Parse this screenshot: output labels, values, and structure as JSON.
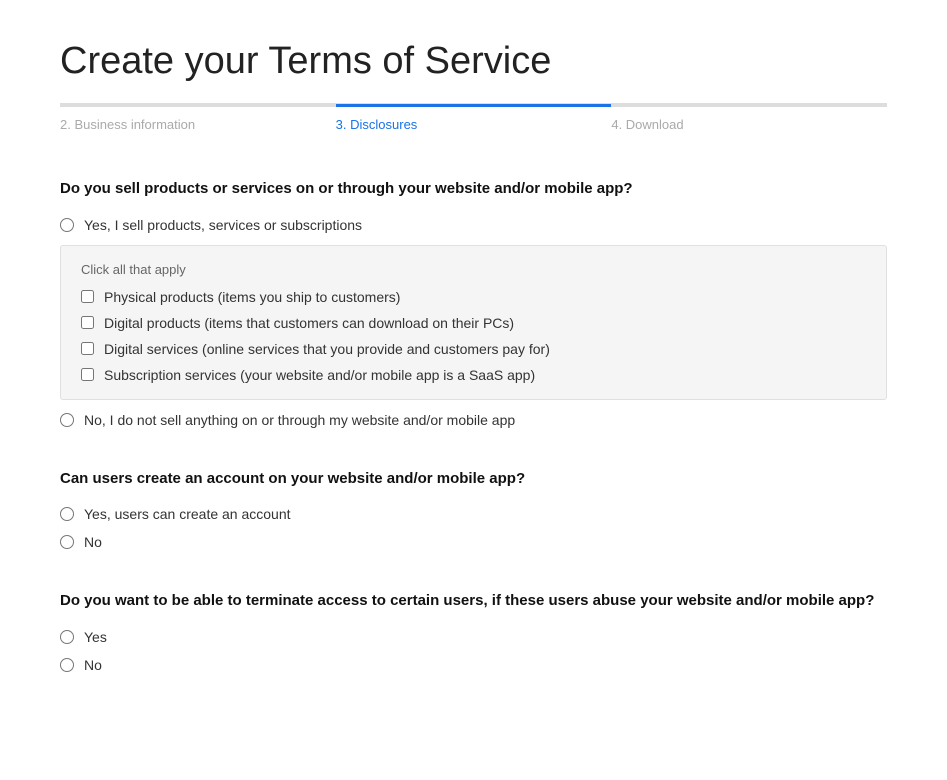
{
  "page": {
    "title": "Create your Terms of Service"
  },
  "stepper": {
    "steps": [
      {
        "id": "business-info",
        "label": "2. Business information",
        "state": "inactive"
      },
      {
        "id": "disclosures",
        "label": "3. Disclosures",
        "state": "active"
      },
      {
        "id": "download",
        "label": "4. Download",
        "state": "inactive"
      }
    ]
  },
  "sections": [
    {
      "id": "sell-products",
      "question": "Do you sell products or services on or through your website and/or mobile app?",
      "options": [
        {
          "id": "sell-yes",
          "label": "Yes, I sell products, services or subscriptions",
          "hasSubgroup": true
        },
        {
          "id": "sell-no",
          "label": "No, I do not sell anything on or through my website and/or mobile app",
          "hasSubgroup": false
        }
      ],
      "subgroup": {
        "label": "Click all that apply",
        "checkboxes": [
          {
            "id": "physical",
            "label": "Physical products (items you ship to customers)"
          },
          {
            "id": "digital-products",
            "label": "Digital products (items that customers can download on their PCs)"
          },
          {
            "id": "digital-services",
            "label": "Digital services (online services that you provide and customers pay for)"
          },
          {
            "id": "subscription",
            "label": "Subscription services (your website and/or mobile app is a SaaS app)"
          }
        ]
      }
    },
    {
      "id": "create-account",
      "question": "Can users create an account on your website and/or mobile app?",
      "options": [
        {
          "id": "account-yes",
          "label": "Yes, users can create an account",
          "hasSubgroup": false
        },
        {
          "id": "account-no",
          "label": "No",
          "hasSubgroup": false
        }
      ]
    },
    {
      "id": "terminate-access",
      "question": "Do you want to be able to terminate access to certain users, if these users abuse your website and/or mobile app?",
      "options": [
        {
          "id": "terminate-yes",
          "label": "Yes",
          "hasSubgroup": false
        },
        {
          "id": "terminate-no",
          "label": "No",
          "hasSubgroup": false
        }
      ]
    }
  ]
}
